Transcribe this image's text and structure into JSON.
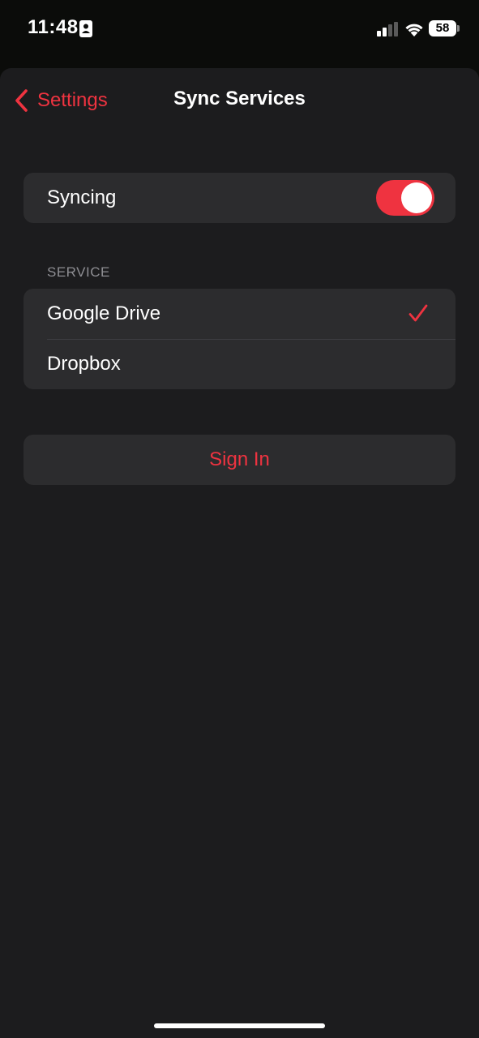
{
  "status_bar": {
    "time": "11:48",
    "battery": "58",
    "icons": [
      "contact-card-icon",
      "cellular-signal-icon",
      "wifi-icon",
      "battery-icon"
    ]
  },
  "nav": {
    "back_label": "Settings",
    "title": "Sync Services"
  },
  "syncing": {
    "label": "Syncing",
    "enabled": true
  },
  "service_section": {
    "header": "SERVICE",
    "options": [
      {
        "label": "Google Drive",
        "selected": true
      },
      {
        "label": "Dropbox",
        "selected": false
      }
    ]
  },
  "sign_in": {
    "label": "Sign In"
  },
  "colors": {
    "accent": "#ef3340",
    "background": "#1c1c1e",
    "cell": "#2c2c2e",
    "secondary_text": "#8e8e93"
  }
}
